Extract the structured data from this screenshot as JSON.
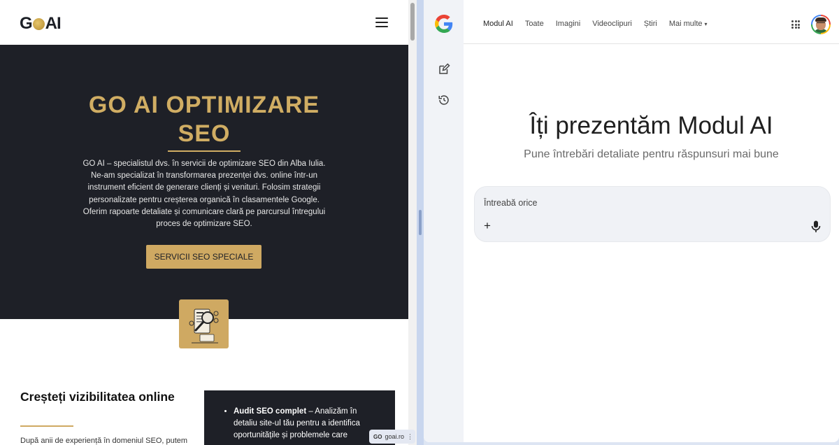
{
  "left_site": {
    "logo_text_left": "G",
    "logo_text_right": "AI",
    "hero": {
      "title": "GO AI OPTIMIZARE SEO",
      "description": "GO AI – specialistul dvs. în servicii de optimizare SEO din Alba Iulia. Ne-am specializat în transformarea prezenței dvs. online într-un instrument eficient de generare clienți și venituri. Folosim strategii personalizate pentru creșterea organică în clasamentele Google. Oferim rapoarte detaliate și comunicare clară pe parcursul întregului proces de optimizare SEO.",
      "cta_label": "SERVICII SEO SPECIALE"
    },
    "section": {
      "title": "Creșteți vizibilitatea online",
      "text": "După anii de experiență în domeniul SEO, putem",
      "card_bold": "Audit SEO complet",
      "card_text": " – Analizăm în detaliu site-ul tău pentru a identifica oportunitățile și problemele care"
    },
    "status_chip": {
      "badge": "GO",
      "domain": "goai.ro",
      "menu": "⋮"
    }
  },
  "right_pane": {
    "tabs": [
      {
        "label": "Modul AI",
        "active": true
      },
      {
        "label": "Toate",
        "active": false
      },
      {
        "label": "Imagini",
        "active": false
      },
      {
        "label": "Videoclipuri",
        "active": false
      },
      {
        "label": "Știri",
        "active": false
      },
      {
        "label": "Mai multe",
        "active": false
      }
    ],
    "more_caret": "▾",
    "ai_mode": {
      "title": "Îți prezentăm Modul AI",
      "subtitle": "Pune întrebări detaliate pentru răspunsuri mai bune",
      "placeholder": "Întreabă orice",
      "plus": "+"
    },
    "icons": {
      "logo": "google-g-icon",
      "rail_top": "edit-icon",
      "rail_second": "history-icon",
      "apps": "apps-grid-icon",
      "mic": "mic-icon"
    },
    "colors": {
      "google_blue": "#4285f4",
      "google_red": "#ea4335",
      "google_yellow": "#fbbc05",
      "google_green": "#34a853"
    }
  },
  "colors": {
    "gold": "#cfa962",
    "dark": "#1e2027"
  }
}
